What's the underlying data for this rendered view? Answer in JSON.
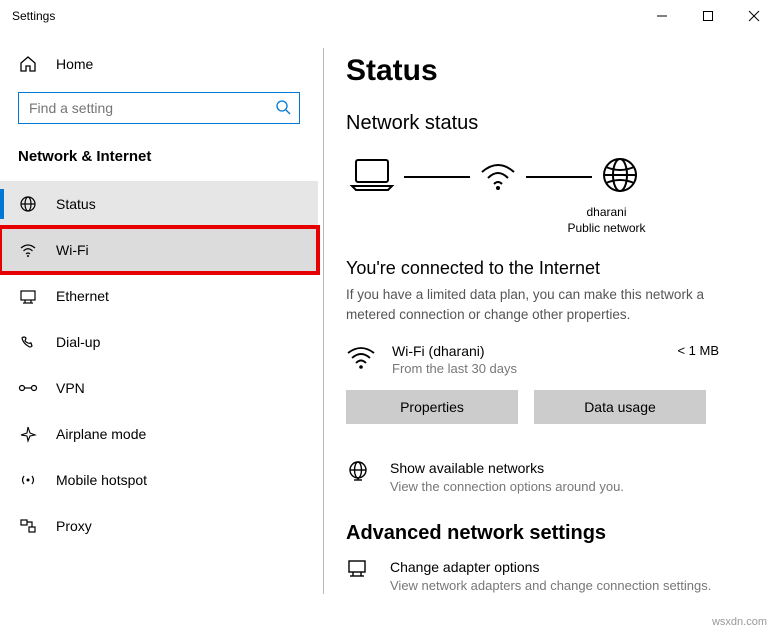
{
  "window": {
    "title": "Settings"
  },
  "sidebar": {
    "home": "Home",
    "search_placeholder": "Find a setting",
    "category": "Network & Internet",
    "items": [
      {
        "label": "Status"
      },
      {
        "label": "Wi-Fi"
      },
      {
        "label": "Ethernet"
      },
      {
        "label": "Dial-up"
      },
      {
        "label": "VPN"
      },
      {
        "label": "Airplane mode"
      },
      {
        "label": "Mobile hotspot"
      },
      {
        "label": "Proxy"
      }
    ]
  },
  "main": {
    "title": "Status",
    "network_status": "Network status",
    "diagram": {
      "ssid": "dharani",
      "net_type": "Public network"
    },
    "connected_title": "You're connected to the Internet",
    "connected_desc": "If you have a limited data plan, you can make this network a metered connection or change other properties.",
    "connection": {
      "name": "Wi-Fi (dharani)",
      "period": "From the last 30 days",
      "usage": "< 1 MB"
    },
    "buttons": {
      "properties": "Properties",
      "data_usage": "Data usage"
    },
    "available": {
      "title": "Show available networks",
      "sub": "View the connection options around you."
    },
    "advanced_heading": "Advanced network settings",
    "adapter": {
      "title": "Change adapter options",
      "sub": "View network adapters and change connection settings."
    }
  },
  "watermark": "wsxdn.com"
}
